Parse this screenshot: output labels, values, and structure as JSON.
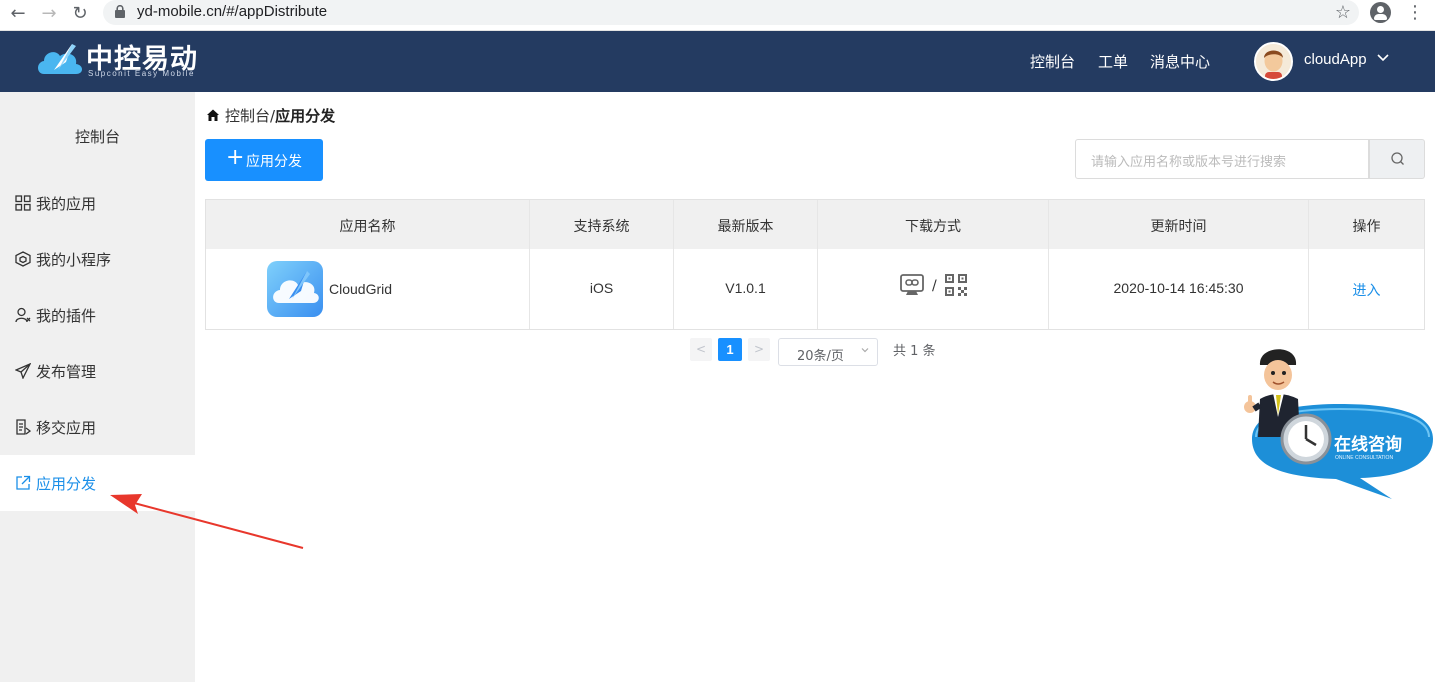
{
  "browser": {
    "url": "yd-mobile.cn/#/appDistribute"
  },
  "header": {
    "logo_text": "中控易动",
    "logo_sub": "Supconit Easy Mobile",
    "nav": [
      "控制台",
      "工单",
      "消息中心"
    ],
    "user_name": "cloudApp"
  },
  "sidebar": {
    "title": "控制台",
    "items": [
      {
        "label": "我的应用",
        "icon": "grid-icon"
      },
      {
        "label": "我的小程序",
        "icon": "cube-icon"
      },
      {
        "label": "我的插件",
        "icon": "user-plugin-icon"
      },
      {
        "label": "发布管理",
        "icon": "send-icon"
      },
      {
        "label": "移交应用",
        "icon": "document-transfer-icon"
      },
      {
        "label": "应用分发",
        "icon": "share-out-icon",
        "active": true
      }
    ]
  },
  "breadcrumb": {
    "root": "控制台",
    "separator": "/",
    "current": "应用分发"
  },
  "toolbar": {
    "add_button": "应用分发",
    "search_placeholder": "请输入应用名称或版本号进行搜索"
  },
  "table": {
    "columns": [
      "应用名称",
      "支持系统",
      "最新版本",
      "下载方式",
      "更新时间",
      "操作"
    ],
    "rows": [
      {
        "name": "CloudGrid",
        "system": "iOS",
        "version": "V1.0.1",
        "download_separator": "/",
        "updated": "2020-10-14 16:45:30",
        "action": "进入"
      }
    ]
  },
  "pagination": {
    "current_page": "1",
    "page_size": "20条/页",
    "total": "共 1 条"
  },
  "consult": {
    "title": "在线咨询",
    "subtitle": "ONLINE CONSULTATION"
  },
  "colors": {
    "header_bg": "#243b61",
    "primary": "#1890ff",
    "link": "#1b8fe8",
    "sidebar_bg": "#f0f0f0",
    "annotation_arrow": "#e8372c"
  }
}
